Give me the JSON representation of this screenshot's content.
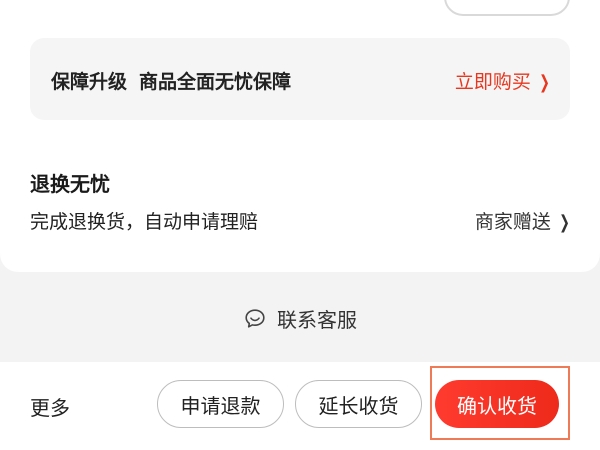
{
  "guarantee_banner": {
    "title": "保障升级",
    "subtitle": "商品全面无忧保障",
    "action": "立即购买",
    "action_color": "#e8371f"
  },
  "return_worry_free": {
    "title": "退换无忧",
    "description": "完成退换货，自动申请理赔",
    "badge": "商家赠送"
  },
  "contact": {
    "label": "联系客服",
    "icon": "chat-bubble-icon"
  },
  "bottom_bar": {
    "more": "更多",
    "refund": "申请退款",
    "extend": "延长收货",
    "confirm": "确认收货",
    "confirm_color": "#ff3b2f"
  },
  "chevron_glyph": "❯"
}
